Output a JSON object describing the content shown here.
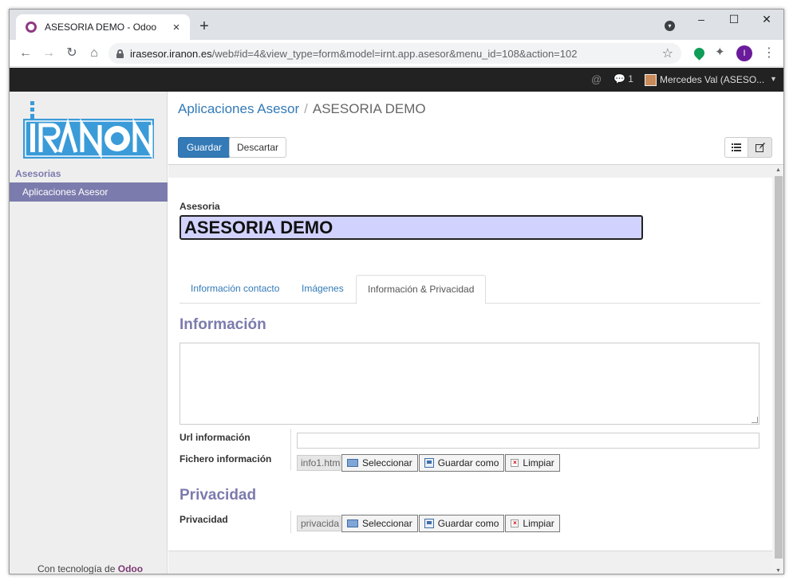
{
  "browser": {
    "tab_title": "ASESORIA DEMO - Odoo",
    "tab_close": "×",
    "new_tab": "+",
    "minimize": "–",
    "maximize": "☐",
    "close": "✕",
    "url_host": "irasesor.iranon.es",
    "url_path": "/web#id=4&view_type=form&model=irnt.app.asesor&menu_id=108&action=102",
    "profile_initial": "I"
  },
  "topbar": {
    "at_symbol": "@",
    "chat_count": "1",
    "user_name": "Mercedes Val (ASESO..."
  },
  "sidebar": {
    "section": "Asesorias",
    "item": "Aplicaciones Asesor",
    "powered_prefix": "Con tecnología de ",
    "powered_brand": "Odoo"
  },
  "breadcrumb": {
    "parent": "Aplicaciones Asesor",
    "separator": "/",
    "current": "ASESORIA DEMO"
  },
  "buttons": {
    "save": "Guardar",
    "discard": "Descartar"
  },
  "form": {
    "name_label": "Asesoria",
    "name_value": "ASESORIA DEMO",
    "tabs": [
      "Información contacto",
      "Imágenes",
      "Información & Privacidad"
    ],
    "active_tab": 2,
    "section_info": "Información",
    "url_label": "Url información",
    "url_value": "",
    "file_label": "Fichero información",
    "file_value": "info1.htm",
    "section_privacy": "Privacidad",
    "privacy_label": "Privacidad",
    "privacy_value": "privacida",
    "btn_select": "Seleccionar",
    "btn_save_as": "Guardar como",
    "btn_clear": "Limpiar"
  },
  "colors": {
    "brand_purple": "#7c7bad",
    "primary_blue": "#337ab7",
    "name_field_bg": "#d2d2ff",
    "topbar_bg": "#222222"
  }
}
